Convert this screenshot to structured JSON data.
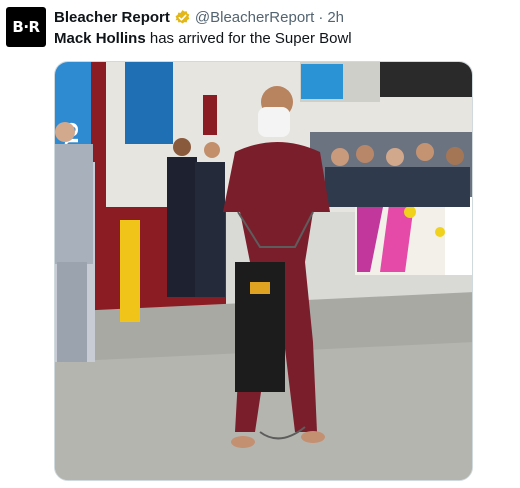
{
  "account": {
    "avatar_text": "B·R",
    "display_name": "Bleacher Report",
    "handle": "@BleacherReport",
    "separator": "·",
    "time": "2h",
    "verified_color": "#e2b719"
  },
  "tweet": {
    "mention": "Mack Hollins",
    "text_rest": " has arrived for the Super Bowl"
  },
  "photo": {
    "alt": "Mack Hollins walking barefoot in a maroon jumpsuit through a stadium tunnel",
    "jumpsuit_color": "#7b1e2b",
    "wall_color": "#e7e5df",
    "floor_color": "#a9a9a4"
  }
}
